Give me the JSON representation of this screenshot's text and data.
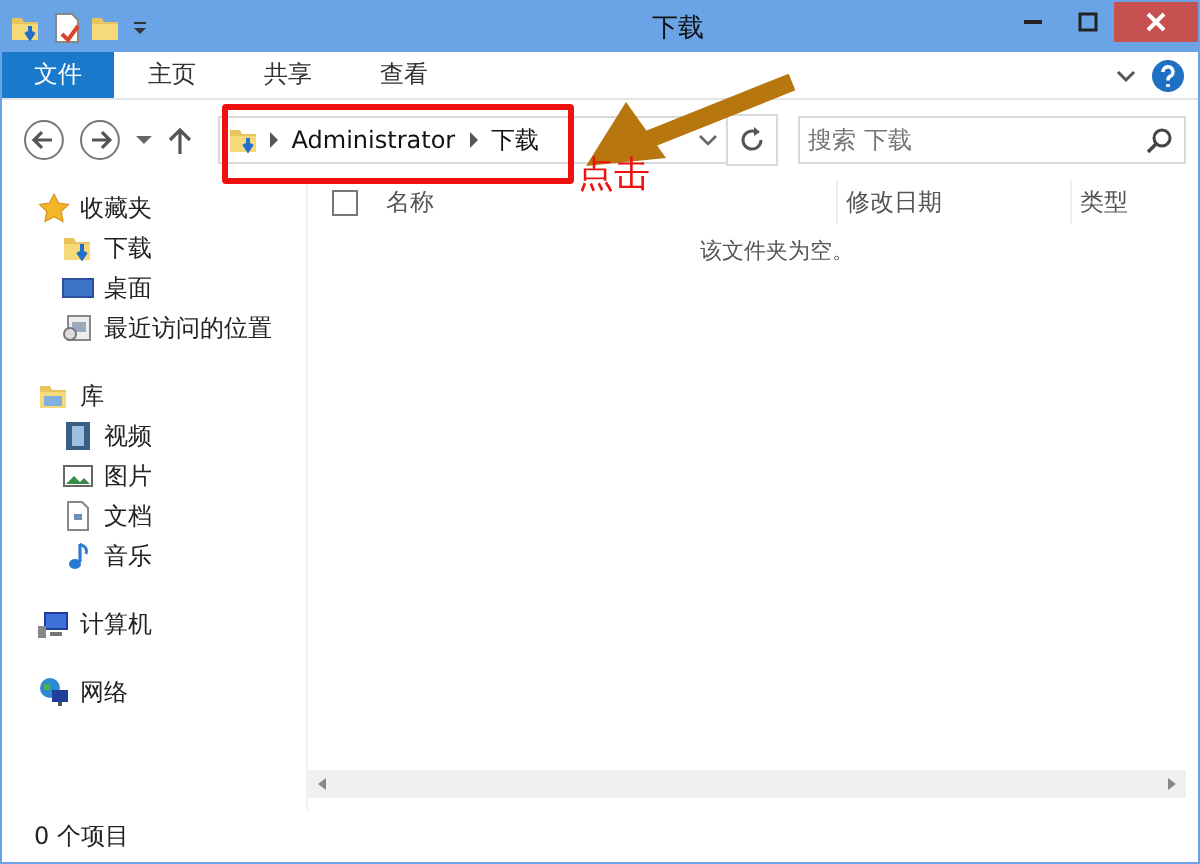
{
  "window": {
    "title": "下载"
  },
  "ribbon": {
    "file_button": "文件",
    "tabs": [
      "主页",
      "共享",
      "查看"
    ]
  },
  "address": {
    "crumbs": [
      "Administrator",
      "下载"
    ]
  },
  "search": {
    "placeholder": "搜索 下载"
  },
  "columns": [
    "名称",
    "修改日期",
    "类型"
  ],
  "select_all": {
    "checked": false
  },
  "empty_message": "该文件夹为空。",
  "nav": [
    {
      "label": "收藏夹",
      "kind": "star",
      "children": [
        {
          "label": "下载",
          "kind": "downloads"
        },
        {
          "label": "桌面",
          "kind": "desktop"
        },
        {
          "label": "最近访问的位置",
          "kind": "recent"
        }
      ]
    },
    {
      "label": "库",
      "kind": "library",
      "children": [
        {
          "label": "视频",
          "kind": "video"
        },
        {
          "label": "图片",
          "kind": "pictures"
        },
        {
          "label": "文档",
          "kind": "documents"
        },
        {
          "label": "音乐",
          "kind": "music"
        }
      ]
    },
    {
      "label": "计算机",
      "kind": "computer"
    },
    {
      "label": "网络",
      "kind": "network"
    }
  ],
  "status_bar": "0 个项目",
  "annotation": {
    "label": "点击"
  }
}
